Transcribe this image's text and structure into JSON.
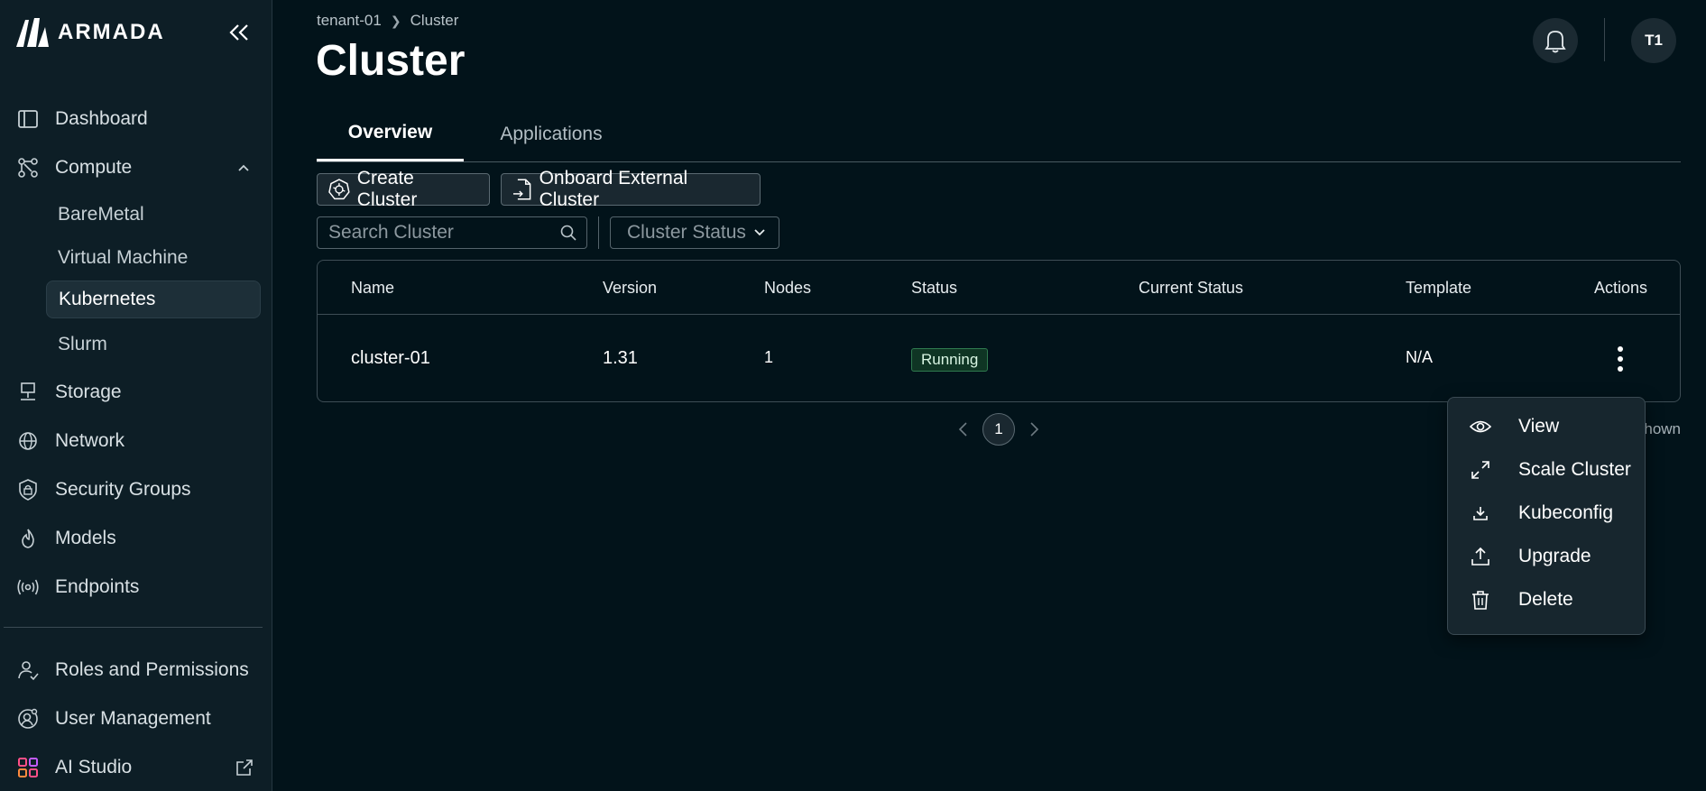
{
  "brand": {
    "name": "ARMADA"
  },
  "sidebar": {
    "items": [
      {
        "key": "dashboard",
        "label": "Dashboard"
      },
      {
        "key": "compute",
        "label": "Compute"
      },
      {
        "key": "storage",
        "label": "Storage"
      },
      {
        "key": "network",
        "label": "Network"
      },
      {
        "key": "security",
        "label": "Security Groups"
      },
      {
        "key": "models",
        "label": "Models"
      },
      {
        "key": "endpoints",
        "label": "Endpoints"
      }
    ],
    "compute_sub": [
      {
        "label": "BareMetal"
      },
      {
        "label": "Virtual Machine"
      },
      {
        "label": "Kubernetes",
        "active": true
      },
      {
        "label": "Slurm"
      }
    ],
    "bottom": [
      {
        "label": "Roles and Permissions"
      },
      {
        "label": "User Management"
      },
      {
        "label": "AI Studio"
      }
    ]
  },
  "breadcrumb": {
    "root": "tenant-01",
    "current": "Cluster"
  },
  "page": {
    "title": "Cluster"
  },
  "header": {
    "avatar_initials": "T1"
  },
  "tabs": [
    {
      "label": "Overview",
      "active": true
    },
    {
      "label": "Applications",
      "active": false
    }
  ],
  "toolbar": {
    "create_label": "Create Cluster",
    "onboard_label": "Onboard External Cluster"
  },
  "filters": {
    "search_placeholder": "Search Cluster",
    "status_label": "Cluster Status"
  },
  "table": {
    "headers": [
      "Name",
      "Version",
      "Nodes",
      "Status",
      "Current Status",
      "Template",
      "Actions"
    ],
    "rows": [
      {
        "name": "cluster-01",
        "version": "1.31",
        "nodes": "1",
        "status": "Running",
        "current_status": "",
        "template": "N/A"
      }
    ]
  },
  "pagination": {
    "page": "1",
    "shown_text": "hown"
  },
  "actions_menu": {
    "items": [
      {
        "label": "View",
        "icon": "eye-icon"
      },
      {
        "label": "Scale Cluster",
        "icon": "expand-icon"
      },
      {
        "label": "Kubeconfig",
        "icon": "download-icon"
      },
      {
        "label": "Upgrade",
        "icon": "upload-icon"
      },
      {
        "label": "Delete",
        "icon": "trash-icon"
      }
    ]
  },
  "colors": {
    "background": "#02131a",
    "sidebar": "#0d1e26",
    "running_badge": "#0f3524",
    "running_border": "#2f7a4f"
  }
}
